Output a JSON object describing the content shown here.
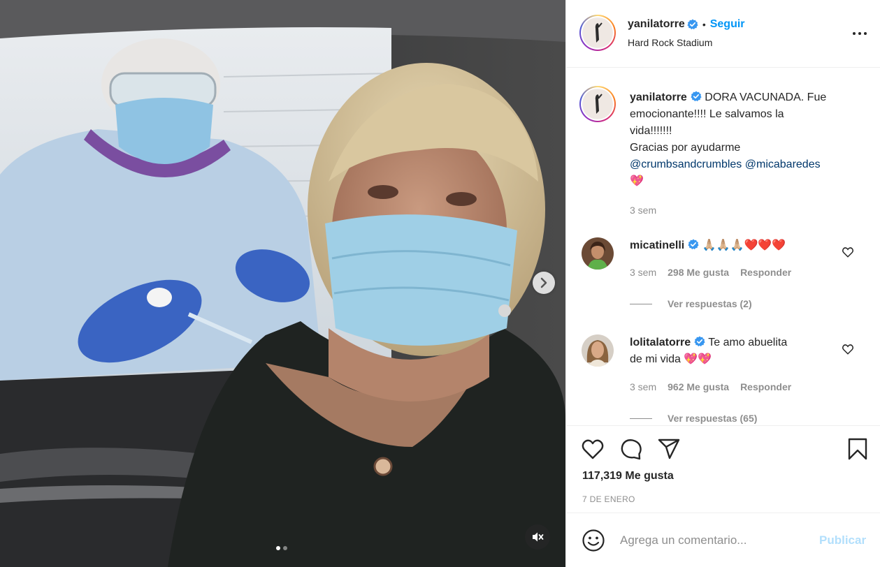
{
  "post": {
    "username": "yanilatorre",
    "follow_label": "Seguir",
    "separator": "•",
    "location": "Hard Rock Stadium",
    "caption_lines": [
      "DORA VACUNADA. Fue",
      "emocionante!!!! Le salvamos la",
      "vida!!!!!!!",
      "Gracias por ayudarme"
    ],
    "caption_mentions": [
      "@crumbsandcrumbles",
      "@micabaredes"
    ],
    "caption_emoji": "💖",
    "caption_time": "3 sem"
  },
  "comments": [
    {
      "username": "micatinelli",
      "text": "🙏🏼🙏🏼🙏🏼❤️❤️❤️",
      "time": "3 sem",
      "likes": "298 Me gusta",
      "reply_label": "Responder",
      "view_replies": "Ver respuestas (2)"
    },
    {
      "username": "lolitalatorre",
      "text_line1": "Te amo abuelita",
      "text_line2": "de mi vida 💖💖",
      "time": "3 sem",
      "likes": "962 Me gusta",
      "reply_label": "Responder",
      "view_replies": "Ver respuestas (65)"
    }
  ],
  "actions": {
    "likes": "117,319 Me gusta",
    "date": "7 DE ENERO"
  },
  "add_comment": {
    "placeholder": "Agrega un comentario...",
    "post_label": "Publicar"
  },
  "media": {
    "carousel_total": 2,
    "carousel_active": 1
  },
  "colors": {
    "accent": "#0095f6",
    "mention": "#00376b",
    "muted": "#8e8e8e",
    "verified": "#3897f0",
    "post_disabled": "#b2dffc"
  },
  "icons": [
    "verified-badge-icon",
    "more-options-icon",
    "heart-icon",
    "comment-icon",
    "share-icon",
    "bookmark-icon",
    "emoji-icon",
    "chevron-right-icon",
    "mute-icon"
  ]
}
